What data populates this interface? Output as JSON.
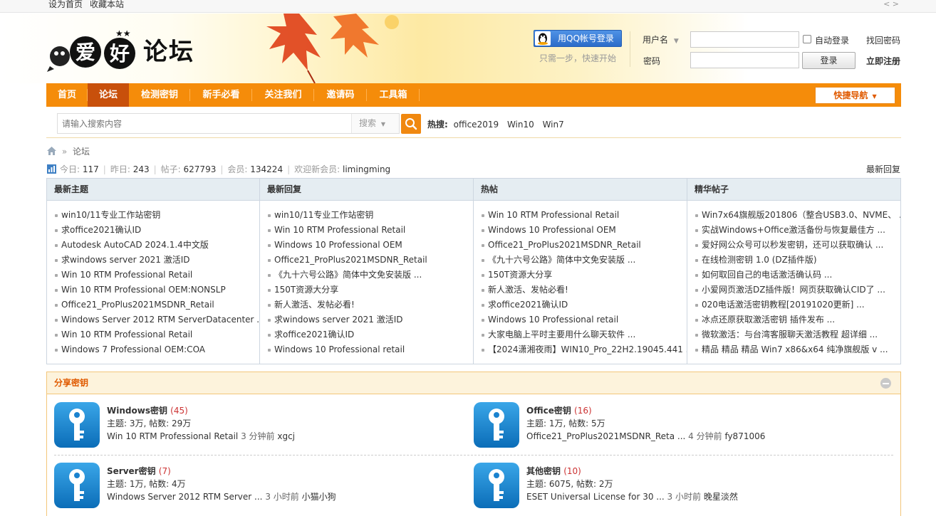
{
  "topbar": {
    "set_home": "设为首页",
    "bookmark": "收藏本站",
    "arrows": "< >"
  },
  "logo": {
    "text": "论坛"
  },
  "login": {
    "qq_button": "用QQ帐号登录",
    "qq_tip": "只需一步，快速开始",
    "username_label": "用户名",
    "password_label": "密码",
    "auto_login": "自动登录",
    "find_password": "找回密码",
    "login_button": "登录",
    "register": "立即注册"
  },
  "nav": {
    "items": [
      "首页",
      "论坛",
      "检测密钥",
      "新手必看",
      "关注我们",
      "邀请码",
      "工具箱"
    ],
    "active_index": 1,
    "quick_nav": "快捷导航"
  },
  "search": {
    "placeholder": "请输入搜索内容",
    "type": "搜索",
    "hot_label": "热搜:",
    "hot_keywords": [
      "office2019",
      "Win10",
      "Win7"
    ]
  },
  "breadcrumb": {
    "sep": "»",
    "current": "论坛"
  },
  "stats": {
    "today_label": "今日:",
    "today": "117",
    "yesterday_label": "昨日:",
    "yesterday": "243",
    "posts_label": "帖子:",
    "posts": "627793",
    "members_label": "会员:",
    "members": "134224",
    "welcome_label": "欢迎新会员:",
    "new_member": "limingming",
    "latest_link": "最新回复"
  },
  "columns": [
    {
      "title": "最新主题",
      "items": [
        "win10/11专业工作站密钥",
        "求office2021确认ID",
        "Autodesk AutoCAD 2024.1.4中文版",
        "求windows server 2021 激活ID",
        "Win 10 RTM Professional Retail",
        "Win 10 RTM Professional OEM:NONSLP",
        "Office21_ProPlus2021MSDNR_Retail",
        "Windows Server 2012 RTM ServerDatacenter ...",
        "Win 10 RTM Professional Retail",
        "Windows 7 Professional OEM:COA"
      ]
    },
    {
      "title": "最新回复",
      "items": [
        "win10/11专业工作站密钥",
        "Win 10 RTM Professional Retail",
        "Windows 10 Professional OEM",
        "Office21_ProPlus2021MSDNR_Retail",
        "《九十六号公路》简体中文免安装版 ...",
        "150T资源大分享",
        "新人激活、发帖必看!",
        "求windows server 2021 激活ID",
        "求office2021确认ID",
        "Windows 10 Professional retail"
      ]
    },
    {
      "title": "热帖",
      "items": [
        "Win 10 RTM Professional Retail",
        "Windows 10 Professional OEM",
        "Office21_ProPlus2021MSDNR_Retail",
        "《九十六号公路》简体中文免安装版 ...",
        "150T资源大分享",
        "新人激活、发帖必看!",
        "求office2021确认ID",
        "Windows 10 Professional retail",
        "大家电脑上平时主要用什么聊天软件 ...",
        "【2024潇湘夜雨】WIN10_Pro_22H2.19045.441 ..."
      ]
    },
    {
      "title": "精华帖子",
      "items": [
        "Win7x64旗舰版201806（整合USB3.0、NVME、 ...",
        "实战Windows+Office激活备份与恢复最佳方 ...",
        "爱好网公众号可以秒发密钥，还可以获取确认 ...",
        "在线检测密钥 1.0 (DZ插件版)",
        "如何取回自己的电话激活确认码 ...",
        "小爱网页激活DZ插件版！网页获取确认CID了 ...",
        "020电话激活密钥教程[20191020更新] ...",
        "冰点还原获取激活密钥 插件发布 ...",
        "微软激活：与台湾客服聊天激活教程 超详细 ...",
        "精品 精品 精品 Win7 x86&x64 纯净旗舰版 v ..."
      ]
    }
  ],
  "share": {
    "title": "分享密钥",
    "forums": [
      {
        "name": "Windows密钥",
        "count": "(45)",
        "meta": "主题: 3万, 帖数: 29万",
        "last": "Win 10 RTM Professional Retail",
        "time": "3 分钟前",
        "user": "xgcj"
      },
      {
        "name": "Office密钥",
        "count": "(16)",
        "meta": "主题: 1万, 帖数: 5万",
        "last": "Office21_ProPlus2021MSDNR_Reta ...",
        "time": "4 分钟前",
        "user": "fy871006"
      },
      {
        "name": "Server密钥",
        "count": "(7)",
        "meta": "主题: 1万, 帖数: 4万",
        "last": "Windows Server 2012 RTM Server ...",
        "time": "3 小时前",
        "user": "小猫小狗"
      },
      {
        "name": "其他密钥",
        "count": "(10)",
        "meta": "主题: 6075, 帖数: 2万",
        "last": "ESET Universal License for 30 ...",
        "time": "3 小时前",
        "user": "晚星淡然"
      }
    ]
  },
  "colors": {
    "nav_bg": "#f58c0a",
    "nav_active": "#c8500b",
    "accent_text": "#e05a00",
    "count_red": "#cc3333",
    "panel_head": "#e5edf2",
    "qq_blue": "#2c6cc9"
  },
  "icons": [
    "qq-penguin-icon",
    "search-icon",
    "home-icon",
    "stats-icon",
    "key-icon",
    "collapse-icon",
    "chevron-down-icon"
  ]
}
